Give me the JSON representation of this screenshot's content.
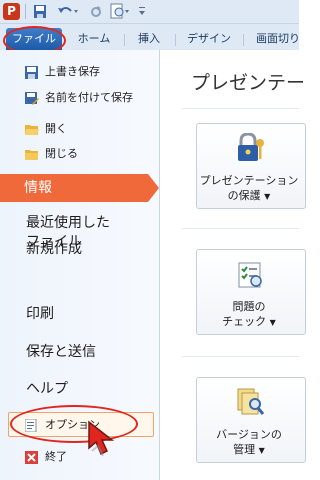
{
  "app": {
    "logo_letter": "P"
  },
  "quick_access": {
    "items": [
      "save",
      "undo",
      "redo",
      "print-preview",
      "customize"
    ]
  },
  "ribbon": {
    "tabs": [
      {
        "label": "ファイル"
      },
      {
        "label": "ホーム"
      },
      {
        "label": "挿入"
      },
      {
        "label": "デザイン"
      },
      {
        "label": "画面切り"
      }
    ]
  },
  "backstage_nav": {
    "commands_top": [
      {
        "label": "上書き保存",
        "icon": "save-icon"
      },
      {
        "label": "名前を付けて保存",
        "icon": "save-as-icon"
      },
      {
        "label": "開く",
        "icon": "folder-open-icon"
      },
      {
        "label": "閉じる",
        "icon": "folder-close-icon"
      }
    ],
    "info": "情報",
    "recent": {
      "line1": "最近使用した",
      "line2": "ファイル"
    },
    "new": "新規作成",
    "print": "印刷",
    "share": "保存と送信",
    "help": "ヘルプ",
    "options": "オプション",
    "exit": "終了"
  },
  "main": {
    "title": "プレゼンテー",
    "buttons": [
      {
        "line1": "プレゼンテーション",
        "line2": "の保護",
        "icon": "lock-key-icon"
      },
      {
        "line1": "問題の",
        "line2": "チェック",
        "icon": "checklist-icon"
      },
      {
        "line1": "バージョンの",
        "line2": "管理",
        "icon": "document-search-icon"
      }
    ]
  },
  "colors": {
    "accent_orange": "#f0693a",
    "annotation_red": "#e0261f",
    "file_tab_blue": "#2563ad"
  }
}
